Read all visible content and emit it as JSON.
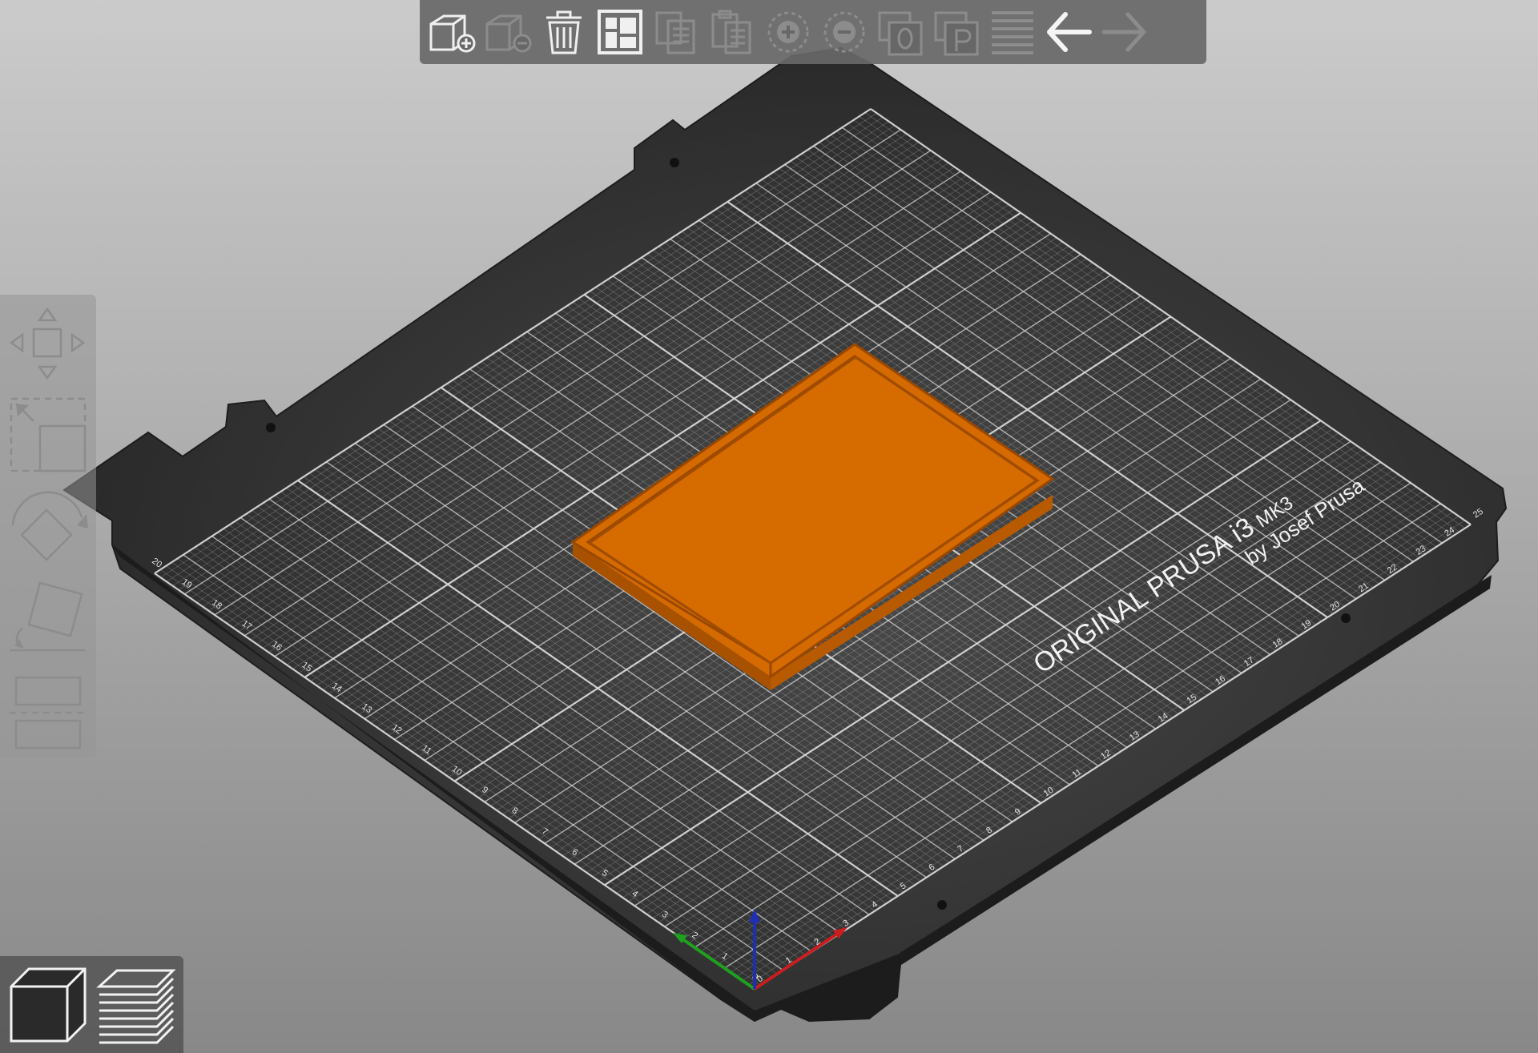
{
  "colors": {
    "background_light": "#c9c9c9",
    "background_dark": "#8a8a8a",
    "bed": "#2b2b2b",
    "bed_grid": "#d8d8d8",
    "object": "#d46a00",
    "object_edge": "#a64e00",
    "toolbar": "#676767",
    "icon_enabled": "#f0f0f0",
    "icon_disabled": "#8c8c8c",
    "axis_x": "#c81e1e",
    "axis_y": "#1fa01f",
    "axis_z": "#1f2fb4"
  },
  "bed": {
    "brand": "ORIGINAL PRUSA i3",
    "model": "MK3",
    "byline": "by Josef Prusa",
    "x_ticks": [
      "0",
      "1",
      "2",
      "3",
      "4",
      "5",
      "6",
      "7",
      "8",
      "9",
      "10",
      "11",
      "12",
      "13",
      "14",
      "15",
      "16",
      "17",
      "18",
      "19",
      "20",
      "21",
      "22",
      "23",
      "24",
      "25"
    ],
    "y_ticks": [
      "0",
      "1",
      "2",
      "3",
      "4",
      "5",
      "6",
      "7",
      "8",
      "9",
      "10",
      "11",
      "12",
      "13",
      "14",
      "15",
      "16",
      "17",
      "18",
      "19",
      "20"
    ]
  },
  "toolbar": {
    "buttons": [
      {
        "name": "add-object-button",
        "icon": "cube-plus-icon",
        "enabled": true
      },
      {
        "name": "delete-object-button",
        "icon": "cube-minus-icon",
        "enabled": false
      },
      {
        "name": "delete-all-button",
        "icon": "trash-icon",
        "enabled": true
      },
      {
        "name": "arrange-button",
        "icon": "arrange-icon",
        "enabled": true
      },
      {
        "name": "copy-button",
        "icon": "copy-icon",
        "enabled": false
      },
      {
        "name": "paste-button",
        "icon": "paste-icon",
        "enabled": false
      },
      {
        "name": "add-instance-button",
        "icon": "plus-circle-icon",
        "enabled": false
      },
      {
        "name": "remove-instance-button",
        "icon": "minus-circle-icon",
        "enabled": false
      },
      {
        "name": "split-objects-button",
        "icon": "split-objects-icon",
        "enabled": false
      },
      {
        "name": "split-parts-button",
        "icon": "split-parts-icon",
        "enabled": false
      },
      {
        "name": "layers-editing-button",
        "icon": "layers-icon",
        "enabled": false
      },
      {
        "name": "undo-button",
        "icon": "arrow-left-icon",
        "enabled": true
      },
      {
        "name": "redo-button",
        "icon": "arrow-right-icon",
        "enabled": false
      }
    ]
  },
  "gizmos": [
    {
      "name": "move-tool",
      "icon": "move-arrows-icon"
    },
    {
      "name": "scale-tool",
      "icon": "scale-icon"
    },
    {
      "name": "rotate-tool",
      "icon": "rotate-icon"
    },
    {
      "name": "place-on-face-tool",
      "icon": "place-on-face-icon"
    },
    {
      "name": "cut-tool",
      "icon": "cut-icon"
    }
  ],
  "views": [
    {
      "name": "3d-view-button",
      "icon": "cube-icon",
      "active": true
    },
    {
      "name": "preview-button",
      "icon": "layers-stack-icon",
      "active": false
    }
  ]
}
